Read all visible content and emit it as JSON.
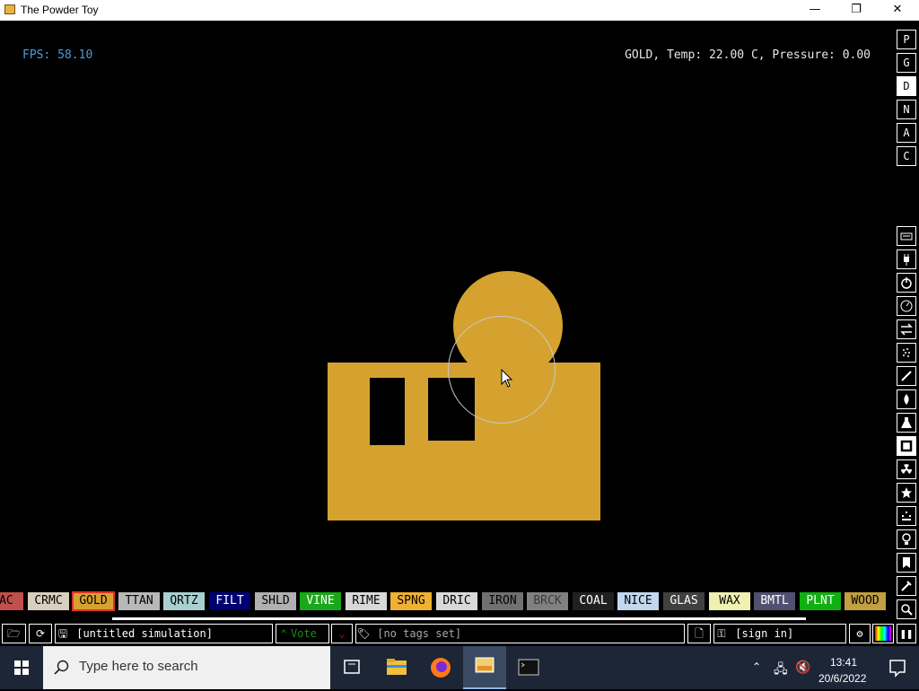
{
  "window": {
    "title": "The Powder Toy",
    "minimize": "—",
    "maximize": "❐",
    "close": "✕"
  },
  "hud": {
    "fps": "FPS: 58.10",
    "element_info": "GOLD, Temp: 22.00 C, Pressure: 0.00"
  },
  "menu_top": [
    "P",
    "G",
    "D",
    "N",
    "A",
    "C"
  ],
  "menu_top_active": "D",
  "menu_side_icons": [
    "keyboard-icon",
    "plug-icon",
    "power-icon",
    "pressure-gauge-icon",
    "transfer-icon",
    "spray-icon",
    "pen-icon",
    "fire-icon",
    "flask-icon",
    "square-wall-icon",
    "radiation-icon",
    "star-icon",
    "dots-icon",
    "bulb-icon",
    "bookmark-icon",
    "tool-icon",
    "search-icon"
  ],
  "elements": [
    {
      "label": "EAC",
      "bg": "#c0504d",
      "fg": "#000000"
    },
    {
      "label": "CRMC",
      "bg": "#d8cfc0",
      "fg": "#000000"
    },
    {
      "label": "GOLD",
      "bg": "#d6a22f",
      "fg": "#000000",
      "selected": true
    },
    {
      "label": "TTAN",
      "bg": "#b8b8b8",
      "fg": "#000000"
    },
    {
      "label": "QRTZ",
      "bg": "#a9d0d0",
      "fg": "#000000"
    },
    {
      "label": "FILT",
      "bg": "#000070",
      "fg": "#ffffff"
    },
    {
      "label": "SHLD",
      "bg": "#b0b0b0",
      "fg": "#000000"
    },
    {
      "label": "VINE",
      "bg": "#19a819",
      "fg": "#ffffff"
    },
    {
      "label": "RIME",
      "bg": "#d8d8d8",
      "fg": "#000000"
    },
    {
      "label": "SPNG",
      "bg": "#f0b030",
      "fg": "#000000"
    },
    {
      "label": "DRIC",
      "bg": "#d8d8d8",
      "fg": "#000000"
    },
    {
      "label": "IRON",
      "bg": "#707070",
      "fg": "#000000"
    },
    {
      "label": "BRCK",
      "bg": "#808080",
      "fg": "#3a3a3a"
    },
    {
      "label": "COAL",
      "bg": "#202020",
      "fg": "#ffffff"
    },
    {
      "label": "NICE",
      "bg": "#c0d8f0",
      "fg": "#000000"
    },
    {
      "label": "GLAS",
      "bg": "#404040",
      "fg": "#ffffff"
    },
    {
      "label": "WAX",
      "bg": "#f0f0b0",
      "fg": "#000000"
    },
    {
      "label": "BMTL",
      "bg": "#505070",
      "fg": "#ffffff"
    },
    {
      "label": "PLNT",
      "bg": "#10b010",
      "fg": "#ffffff"
    },
    {
      "label": "WOOD",
      "bg": "#c0a040",
      "fg": "#000000"
    }
  ],
  "bottom": {
    "sim_name": "[untitled simulation]",
    "vote": "Vote",
    "tags": "[no tags set]",
    "sign_in": "[sign in]"
  },
  "taskbar": {
    "search_placeholder": "Type here to search",
    "time": "13:41",
    "date": "20/6/2022"
  },
  "colors": {
    "gold": "#d6a22f",
    "fps_blue": "#4f9bd9"
  }
}
